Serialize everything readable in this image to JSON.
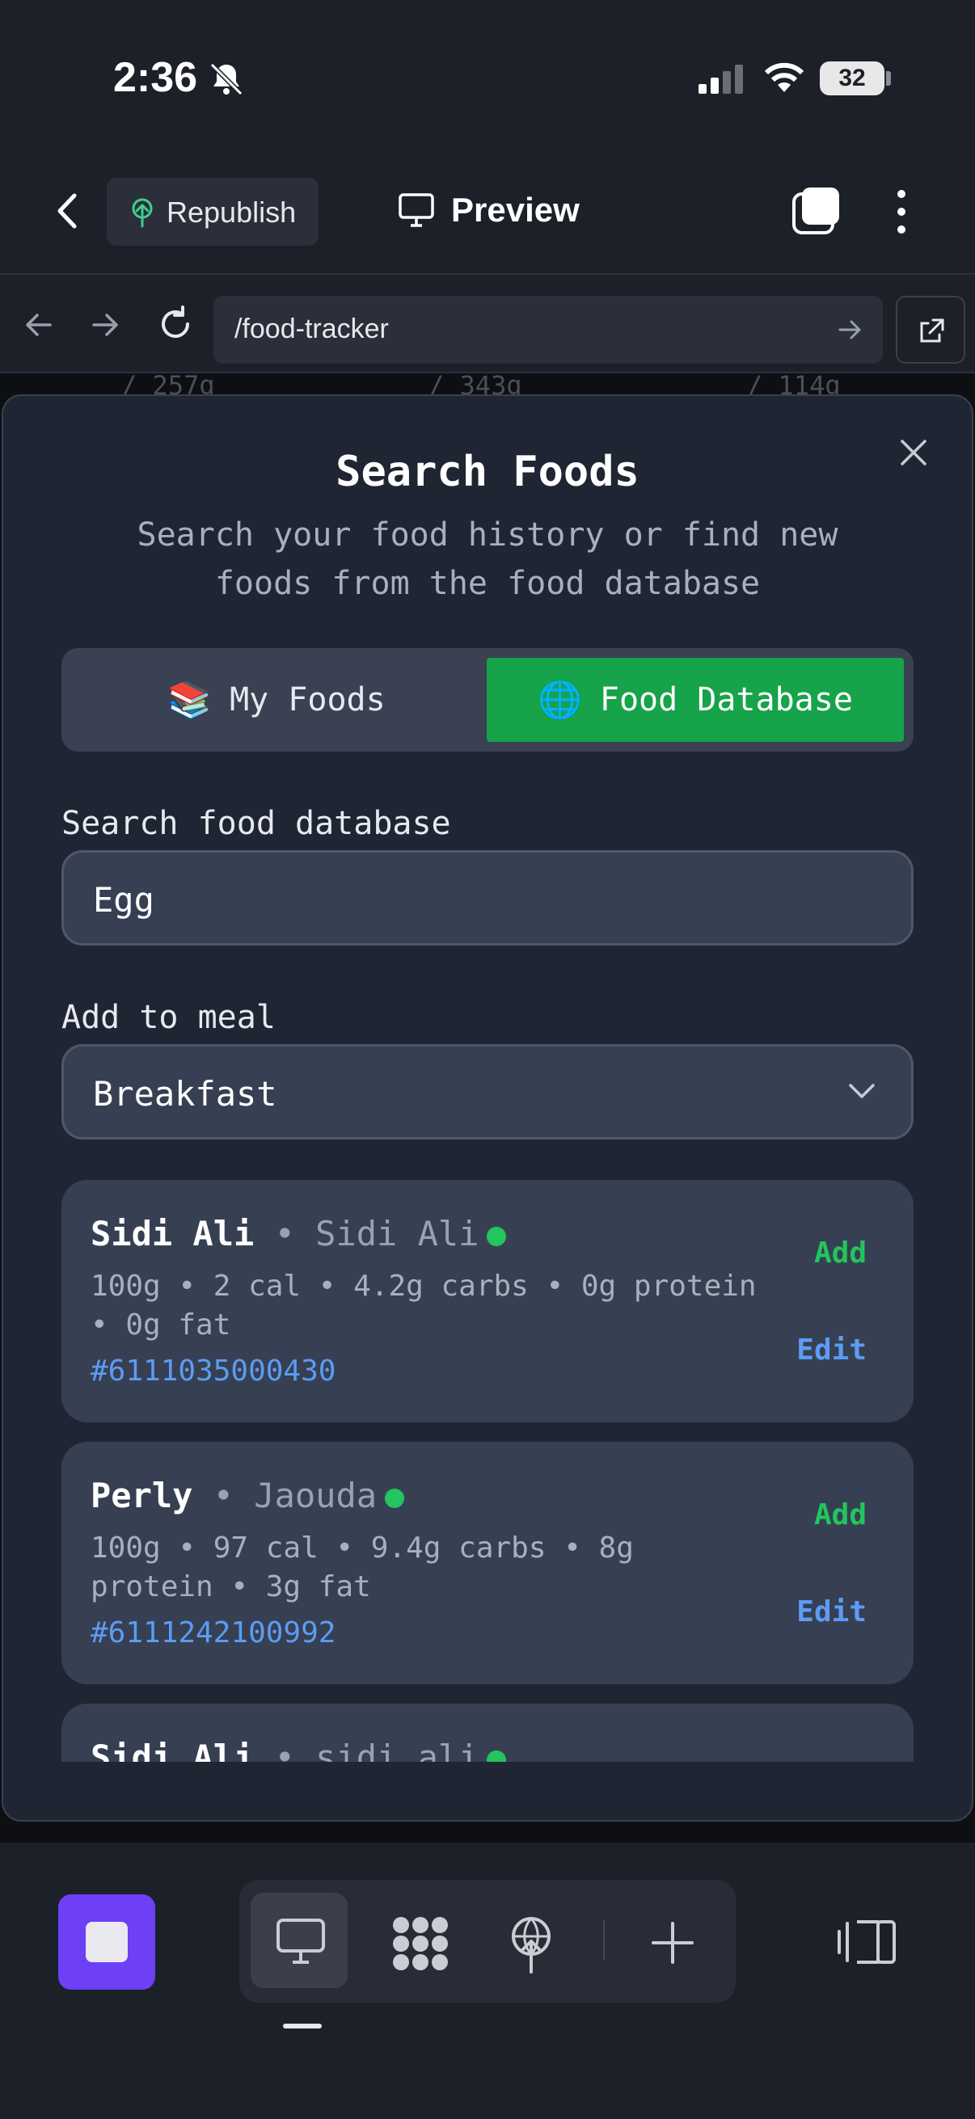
{
  "status_bar": {
    "time": "2:36",
    "battery": "32"
  },
  "header": {
    "republish_label": "Republish",
    "preview_label": "Preview"
  },
  "browser": {
    "url": "/food-tracker"
  },
  "background": {
    "values": [
      "/ 257g",
      "/ 343g",
      "/ 114g"
    ]
  },
  "modal": {
    "title": "Search Foods",
    "subtitle": "Search your food history or find new foods from the food database",
    "tabs": [
      {
        "emoji": "📚",
        "label": "My Foods"
      },
      {
        "emoji": "🌐",
        "label": "Food Database"
      }
    ],
    "search": {
      "label": "Search food database",
      "value": "Egg"
    },
    "meal": {
      "label": "Add to meal",
      "value": "Breakfast"
    },
    "results": [
      {
        "name": "Sidi Ali",
        "brand": "Sidi Ali",
        "macros": "100g • 2 cal • 4.2g carbs • 0g protein • 0g fat",
        "code": "#6111035000430",
        "add": "Add",
        "edit": "Edit"
      },
      {
        "name": "Perly",
        "brand": "Jaouda",
        "macros": "100g • 97 cal • 9.4g carbs • 8g protein • 3g fat",
        "code": "#6111242100992",
        "add": "Add",
        "edit": "Edit"
      },
      {
        "name": "Sidi Ali",
        "brand": "sidi ali",
        "macros": "",
        "code": "",
        "add": "",
        "edit": ""
      }
    ]
  },
  "colors": {
    "accent_green": "#16a34a",
    "link_blue": "#5b9cf5",
    "stop_purple": "#6d3ff5"
  }
}
